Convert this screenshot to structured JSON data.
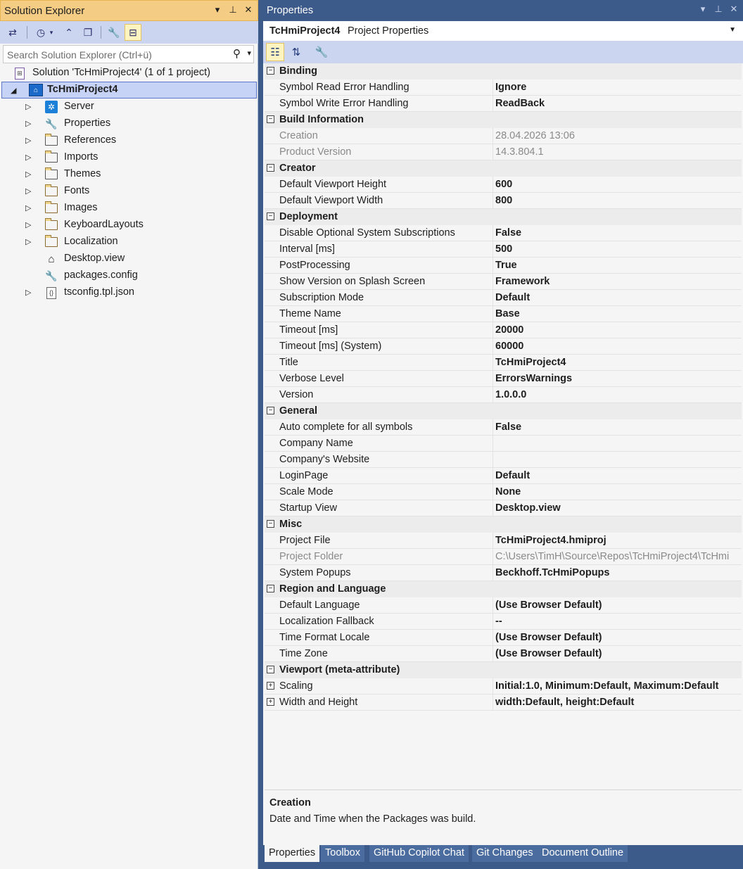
{
  "solution_explorer": {
    "title": "Solution Explorer",
    "window_glyphs": [
      "▾",
      "⊥",
      "✕"
    ],
    "search_placeholder": "Search Solution Explorer (Ctrl+ü)",
    "solution_label": "Solution 'TcHmiProject4' (1 of 1 project)",
    "project_label": "TcHmiProject4",
    "items": [
      {
        "label": "Server",
        "icon": "server-icon",
        "expandable": true
      },
      {
        "label": "Properties",
        "icon": "wrench-icon",
        "expandable": true
      },
      {
        "label": "References",
        "icon": "references-icon",
        "expandable": true
      },
      {
        "label": "Imports",
        "icon": "imports-folder-icon",
        "expandable": true
      },
      {
        "label": "Themes",
        "icon": "themes-icon",
        "expandable": true
      },
      {
        "label": "Fonts",
        "icon": "folder-icon",
        "expandable": true
      },
      {
        "label": "Images",
        "icon": "folder-icon",
        "expandable": true
      },
      {
        "label": "KeyboardLayouts",
        "icon": "folder-icon",
        "expandable": true
      },
      {
        "label": "Localization",
        "icon": "folder-icon",
        "expandable": true
      },
      {
        "label": "Desktop.view",
        "icon": "home-icon",
        "expandable": false
      },
      {
        "label": "packages.config",
        "icon": "config-icon",
        "expandable": false
      },
      {
        "label": "tsconfig.tpl.json",
        "icon": "json-file-icon",
        "expandable": true
      }
    ]
  },
  "properties": {
    "title": "Properties",
    "window_glyphs": [
      "▾",
      "⊥",
      "✕"
    ],
    "object_name": "TcHmiProject4",
    "object_type": "Project Properties",
    "categories": [
      {
        "name": "Binding",
        "rows": [
          {
            "name": "Symbol Read Error Handling",
            "value": "Ignore"
          },
          {
            "name": "Symbol Write Error Handling",
            "value": "ReadBack"
          }
        ]
      },
      {
        "name": "Build Information",
        "rows": [
          {
            "name": "Creation",
            "value": "28.04.2026 13:06",
            "readonly": true
          },
          {
            "name": "Product Version",
            "value": "14.3.804.1",
            "readonly": true
          }
        ]
      },
      {
        "name": "Creator",
        "rows": [
          {
            "name": "Default Viewport Height",
            "value": "600"
          },
          {
            "name": "Default Viewport Width",
            "value": "800"
          }
        ]
      },
      {
        "name": "Deployment",
        "rows": [
          {
            "name": "Disable Optional System Subscriptions",
            "value": "False"
          },
          {
            "name": "Interval [ms]",
            "value": "500"
          },
          {
            "name": "PostProcessing",
            "value": "True"
          },
          {
            "name": "Show Version on Splash Screen",
            "value": "Framework"
          },
          {
            "name": "Subscription Mode",
            "value": "Default"
          },
          {
            "name": "Theme Name",
            "value": "Base"
          },
          {
            "name": "Timeout [ms]",
            "value": "20000"
          },
          {
            "name": "Timeout [ms] (System)",
            "value": "60000"
          },
          {
            "name": "Title",
            "value": "TcHmiProject4"
          },
          {
            "name": "Verbose Level",
            "value": "ErrorsWarnings"
          },
          {
            "name": "Version",
            "value": "1.0.0.0"
          }
        ]
      },
      {
        "name": "General",
        "rows": [
          {
            "name": "Auto complete for all symbols",
            "value": "False"
          },
          {
            "name": "Company Name",
            "value": ""
          },
          {
            "name": "Company's Website",
            "value": ""
          },
          {
            "name": "LoginPage",
            "value": "Default"
          },
          {
            "name": "Scale Mode",
            "value": "None"
          },
          {
            "name": "Startup View",
            "value": "Desktop.view"
          }
        ]
      },
      {
        "name": "Misc",
        "rows": [
          {
            "name": "Project File",
            "value": "TcHmiProject4.hmiproj"
          },
          {
            "name": "Project Folder",
            "value": "C:\\Users\\TimH\\Source\\Repos\\TcHmiProject4\\TcHmi",
            "readonly": true
          },
          {
            "name": "System Popups",
            "value": "Beckhoff.TcHmiPopups"
          }
        ]
      },
      {
        "name": "Region and Language",
        "rows": [
          {
            "name": "Default Language",
            "value": "(Use Browser Default)"
          },
          {
            "name": "Localization Fallback",
            "value": "--"
          },
          {
            "name": "Time Format Locale",
            "value": "(Use Browser Default)"
          },
          {
            "name": "Time Zone",
            "value": "(Use Browser Default)"
          }
        ]
      },
      {
        "name": "Viewport (meta-attribute)",
        "rows": [
          {
            "name": "Scaling",
            "value": "Initial:1.0, Minimum:Default, Maximum:Default",
            "expandable": true
          },
          {
            "name": "Width and Height",
            "value": "width:Default, height:Default",
            "expandable": true
          }
        ]
      }
    ],
    "description": {
      "title": "Creation",
      "text": "Date and Time when the Packages was build."
    },
    "tabs": [
      "Properties",
      "Toolbox",
      "GitHub Copilot Chat",
      "Git Changes",
      "Document Outline"
    ],
    "active_tab": "Properties"
  }
}
